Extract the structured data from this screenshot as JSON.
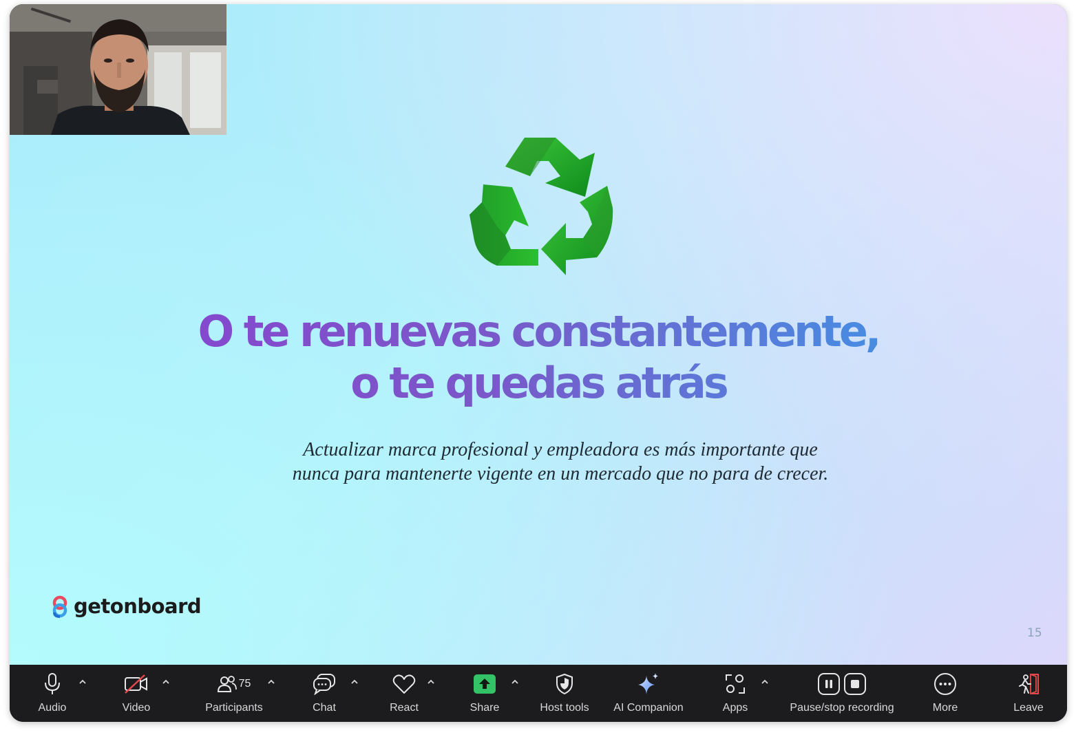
{
  "slide": {
    "headline_line1": "O te renuevas constantemente,",
    "headline_line2": "o te quedas atrás",
    "subtitle_line1": "Actualizar marca profesional y empleadora es más importante que",
    "subtitle_line2": "nunca para mantenerte vigente en un mercado que no para de crecer.",
    "logo_text": "getonboard",
    "slide_number": "15",
    "icon": "recycle-icon"
  },
  "toolbar": {
    "audio": "Audio",
    "video": "Video",
    "participants": "Participants",
    "participants_count": "75",
    "chat": "Chat",
    "react": "React",
    "share": "Share",
    "host_tools": "Host tools",
    "ai_companion": "AI Companion",
    "apps": "Apps",
    "recording": "Pause/stop recording",
    "more": "More",
    "leave": "Leave"
  },
  "colors": {
    "share_accent": "#33c266",
    "leave_accent": "#e5484d",
    "toolbar_bg": "#1c1c1e"
  }
}
